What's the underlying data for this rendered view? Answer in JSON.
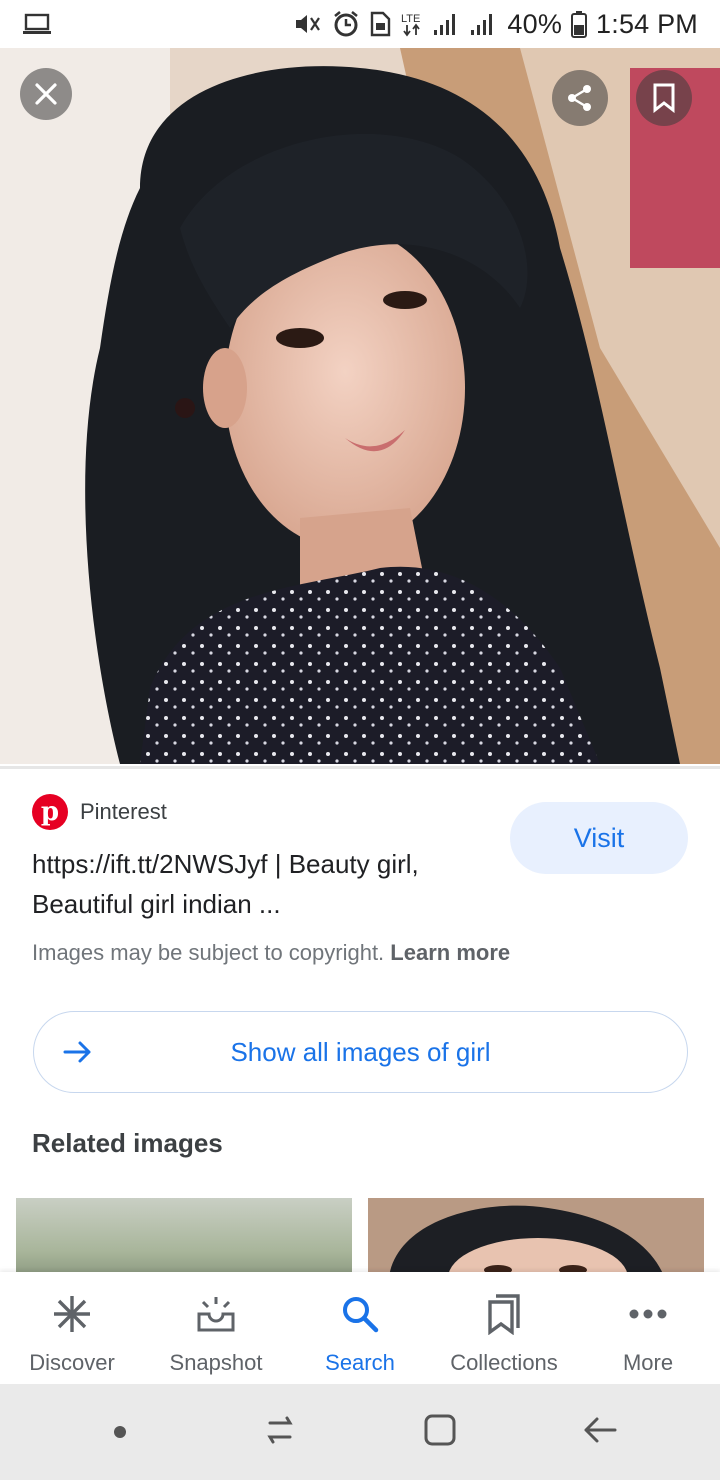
{
  "status_bar": {
    "battery": "40%",
    "time": "1:54 PM",
    "network": "LTE"
  },
  "image_actions": {
    "close_icon": "close-icon",
    "share_icon": "share-icon",
    "save_icon": "bookmark-icon"
  },
  "result": {
    "source_name": "Pinterest",
    "title": "https://ift.tt/2NWSJyf | Beauty girl, Beautiful girl indian ...",
    "visit_label": "Visit",
    "copyright_text": "Images may be subject to copyright.",
    "learn_more_label": "Learn more",
    "show_all_label": "Show all images of girl"
  },
  "related": {
    "title": "Related images"
  },
  "bottom_nav": {
    "items": [
      {
        "label": "Discover",
        "icon": "asterisk-icon"
      },
      {
        "label": "Snapshot",
        "icon": "snapshot-icon"
      },
      {
        "label": "Search",
        "icon": "search-icon"
      },
      {
        "label": "Collections",
        "icon": "collections-icon"
      },
      {
        "label": "More",
        "icon": "more-icon"
      }
    ],
    "active": "Search"
  },
  "colors": {
    "accent": "#1a73e8",
    "pinterest": "#e60023",
    "visit_bg": "#e8f0fe"
  }
}
